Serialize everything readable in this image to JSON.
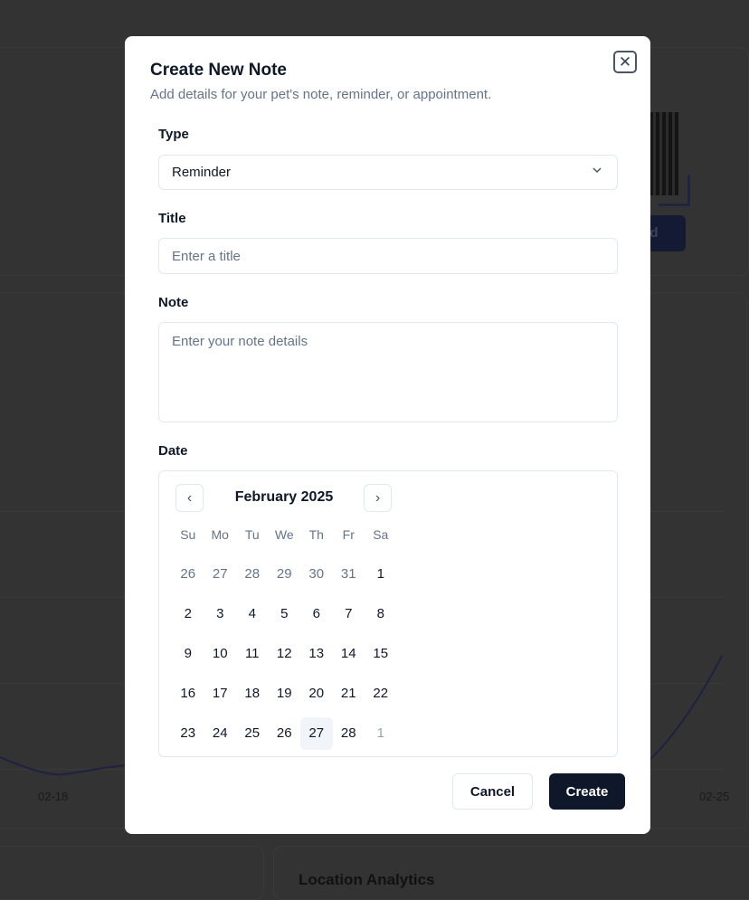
{
  "background": {
    "partial_button_label": "ad",
    "x_ticks": [
      "02-18",
      "02-25"
    ],
    "bottom_card_title": "Location Analytics"
  },
  "dialog": {
    "title": "Create New Note",
    "subtitle": "Add details for your pet's note, reminder, or appointment.",
    "close_icon": "x-icon",
    "type": {
      "label": "Type",
      "value": "Reminder"
    },
    "title_field": {
      "label": "Title",
      "placeholder": "Enter a title",
      "value": ""
    },
    "note_field": {
      "label": "Note",
      "placeholder": "Enter your note details",
      "value": ""
    },
    "date": {
      "label": "Date",
      "month": "February 2025",
      "weekdays": [
        "Su",
        "Mo",
        "Tu",
        "We",
        "Th",
        "Fr",
        "Sa"
      ],
      "weeks": [
        [
          "26",
          "27",
          "28",
          "29",
          "30",
          "31",
          "1"
        ],
        [
          "2",
          "3",
          "4",
          "5",
          "6",
          "7",
          "8"
        ],
        [
          "9",
          "10",
          "11",
          "12",
          "13",
          "14",
          "15"
        ],
        [
          "16",
          "17",
          "18",
          "19",
          "20",
          "21",
          "22"
        ],
        [
          "23",
          "24",
          "25",
          "26",
          "27",
          "28",
          "1"
        ]
      ],
      "today": "27"
    },
    "cancel_label": "Cancel",
    "create_label": "Create"
  }
}
